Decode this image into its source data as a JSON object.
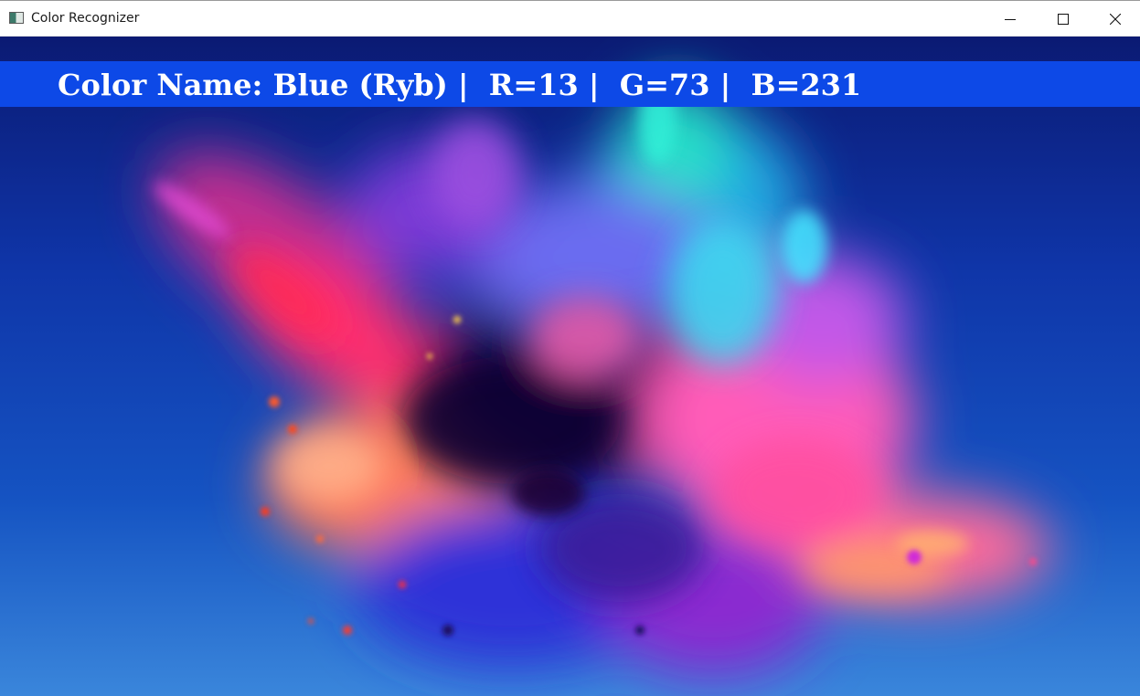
{
  "window": {
    "title": "Color Recognizer",
    "icon": "app-window-icon"
  },
  "caption_buttons": {
    "minimize_icon": "minimize-icon",
    "maximize_icon": "maximize-icon",
    "close_icon": "close-icon"
  },
  "banner": {
    "text": "Color Name: Blue (Ryb) |  R=13 |  G=73 |  B=231",
    "color_name": "Blue (Ryb)",
    "r": 13,
    "g": 73,
    "b": 231,
    "background": "#0d49e7",
    "text_color": "#ffffff"
  },
  "image": {
    "description_icon": "color-powder-explosion-image"
  }
}
